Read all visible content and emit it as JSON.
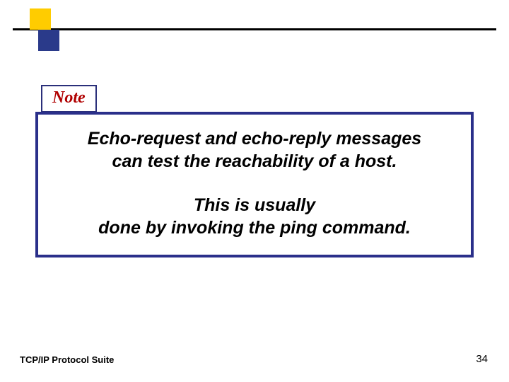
{
  "note": {
    "label": "Note"
  },
  "content": {
    "line1": "Echo-request and echo-reply messages",
    "line2": "can test the reachability of a host.",
    "line3": "This is usually",
    "line4": "done by invoking the ping command."
  },
  "footer": {
    "left": "TCP/IP Protocol Suite",
    "page": "34"
  }
}
